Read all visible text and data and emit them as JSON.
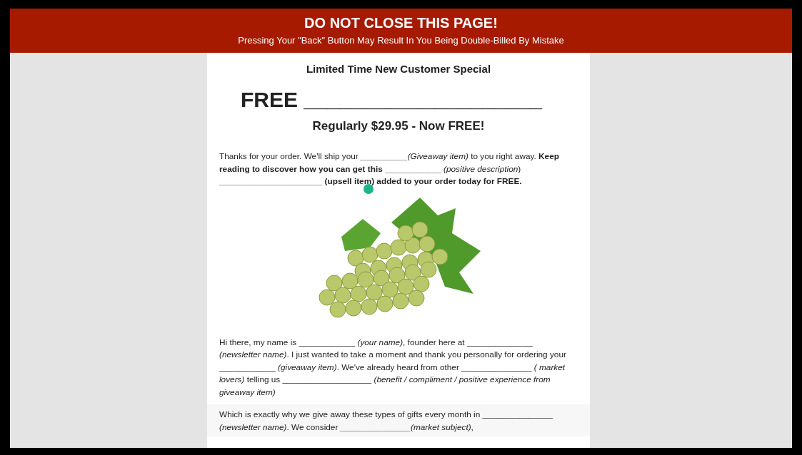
{
  "banner": {
    "title": "DO NOT CLOSE THIS PAGE!",
    "subtitle": "Pressing Your \"Back\" Button May Result In You Being Double-Billed By Mistake"
  },
  "offer": {
    "kicker": "Limited Time New Customer Special",
    "headline": "FREE ____________________",
    "price": "Regularly $29.95 - Now FREE!"
  },
  "paragraphs": [
    {
      "text": "Thanks for your order. We'll ship your *__________(Giveaway item)* to you right away. **Keep reading to discover how you can get this ____________** *(positive description*) **______________________ (upsell item) added to your order today for FREE.**"
    },
    {
      "text": "Hi there, my name is ____________ *(your name)*, founder here at ______________ *(newsletter name)*. I just wanted to take a moment and thank you personally for ordering your ____________ *(giveaway item)*. We've already heard from other _______________ *( market lovers)* telling us ___________________ *(benefit / compliment / positive experience from giveaway item)*"
    },
    {
      "text": "Which is exactly why we give away these types of gifts every month in _______________ *(newsletter name)*. We consider *_______________(market subject)*,"
    }
  ]
}
